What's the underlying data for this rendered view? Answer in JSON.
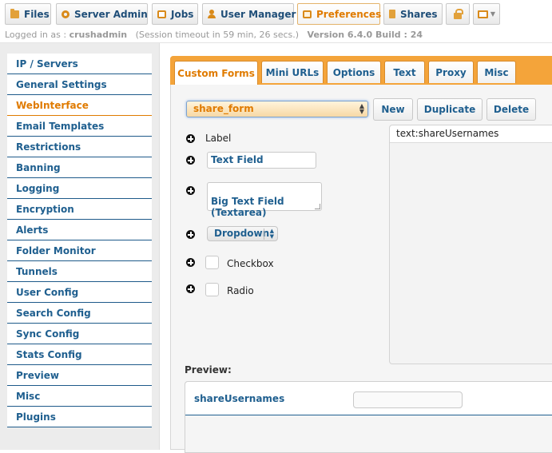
{
  "toolbar": {
    "files": "Files",
    "server_admin": "Server Admin",
    "jobs": "Jobs",
    "user_manager": "User Manager",
    "preferences": "Preferences",
    "shares": "Shares",
    "colors": {
      "accent": "#e07b00",
      "link": "#1f5f8f",
      "tab_bar": "#f4a43a"
    }
  },
  "status": {
    "logged_in_prefix": "Logged in as :",
    "username": "crushadmin",
    "session": "(Session timeout in 59 min, 26 secs.)",
    "version": "Version 6.4.0 Build : 24"
  },
  "sidebar": {
    "items": [
      {
        "label": "IP / Servers"
      },
      {
        "label": "General Settings"
      },
      {
        "label": "WebInterface",
        "active": true
      },
      {
        "label": "Email Templates"
      },
      {
        "label": "Restrictions"
      },
      {
        "label": "Banning"
      },
      {
        "label": "Logging"
      },
      {
        "label": "Encryption"
      },
      {
        "label": "Alerts"
      },
      {
        "label": "Folder Monitor"
      },
      {
        "label": "Tunnels"
      },
      {
        "label": "User Config"
      },
      {
        "label": "Search Config"
      },
      {
        "label": "Sync Config"
      },
      {
        "label": "Stats Config"
      },
      {
        "label": "Preview"
      },
      {
        "label": "Misc"
      },
      {
        "label": "Plugins"
      }
    ]
  },
  "tabs": [
    "Custom Forms",
    "Mini URLs",
    "Options",
    "Text",
    "Proxy",
    "Misc"
  ],
  "form": {
    "selected": "share_form",
    "new_label": "New",
    "duplicate_label": "Duplicate",
    "delete_label": "Delete"
  },
  "elements": {
    "label": "Label",
    "text_field": "Text Field",
    "big_text_field": "Big Text Field\n(Textarea)",
    "dropdown": "Dropdown",
    "checkbox": "Checkbox",
    "radio": "Radio"
  },
  "form_items": [
    "text:shareUsernames"
  ],
  "preview": {
    "title": "Preview:",
    "field_label": "shareUsernames",
    "field_value": ""
  }
}
